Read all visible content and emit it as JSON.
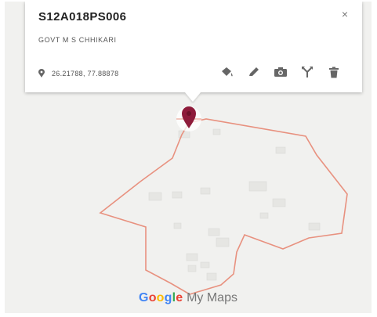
{
  "popup": {
    "title": "S12A018PS006",
    "subtitle": "GOVT M S CHHIKARI",
    "coordinates": "26.21788, 77.88878",
    "close_glyph": "×",
    "tools": [
      "paint-bucket-icon",
      "pencil-icon",
      "camera-icon",
      "directions-icon",
      "trash-icon"
    ]
  },
  "footer": {
    "brand_letters": [
      "G",
      "o",
      "o",
      "g",
      "l",
      "e"
    ],
    "product": "My Maps"
  },
  "colors": {
    "marker": "#8e1b3a",
    "polygon_stroke": "#e8917f",
    "map_background": "#f1f1ef"
  }
}
